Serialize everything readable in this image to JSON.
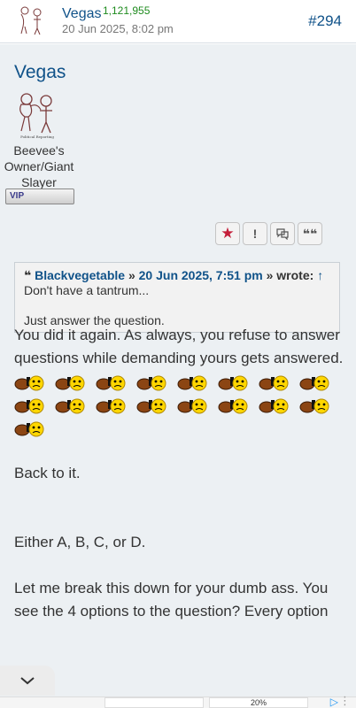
{
  "header": {
    "username": "Vegas",
    "post_count": "1,121,955",
    "date": "20 Jun 2025, 8:02 pm",
    "post_number": "#294"
  },
  "author": {
    "name": "Vegas",
    "avatar_caption": "Political Reporting",
    "rank_line1": "Beevee's",
    "rank_line2": "Owner/Giant",
    "rank_line3": "Slayer",
    "badge": "VIP"
  },
  "actions": {
    "icons": [
      "star-icon",
      "report-icon",
      "chat-icon",
      "quote-icon"
    ],
    "star_glyph": "★",
    "report_glyph": "!",
    "quote_glyph": "❝❝"
  },
  "quote": {
    "icon": "❝",
    "author": "Blackvegetable",
    "separator1": "»",
    "date": "20 Jun 2025, 7:51 pm",
    "separator2": "»",
    "wrote": "wrote:",
    "arrow": "↑",
    "line1": "Don't have a tantrum...",
    "line2": "Just answer the question."
  },
  "content": {
    "para1": "You did it again. As always, you refuse to answer questions while demanding yours gets answered.",
    "smiley_count": 17,
    "para2": "Back to it.",
    "para3": "Either A, B, C, or D.",
    "para4": "Let me break this down for your dumb ass. You see the 4 options to the question? Every option"
  },
  "ad": {
    "play_glyph": "▷",
    "menu_glyph": "⋮",
    "badge": "20%"
  },
  "colors": {
    "link": "#105289",
    "post_count": "#1e8b1e",
    "post_bg": "#ecf0f3",
    "star": "#c41e3a"
  }
}
